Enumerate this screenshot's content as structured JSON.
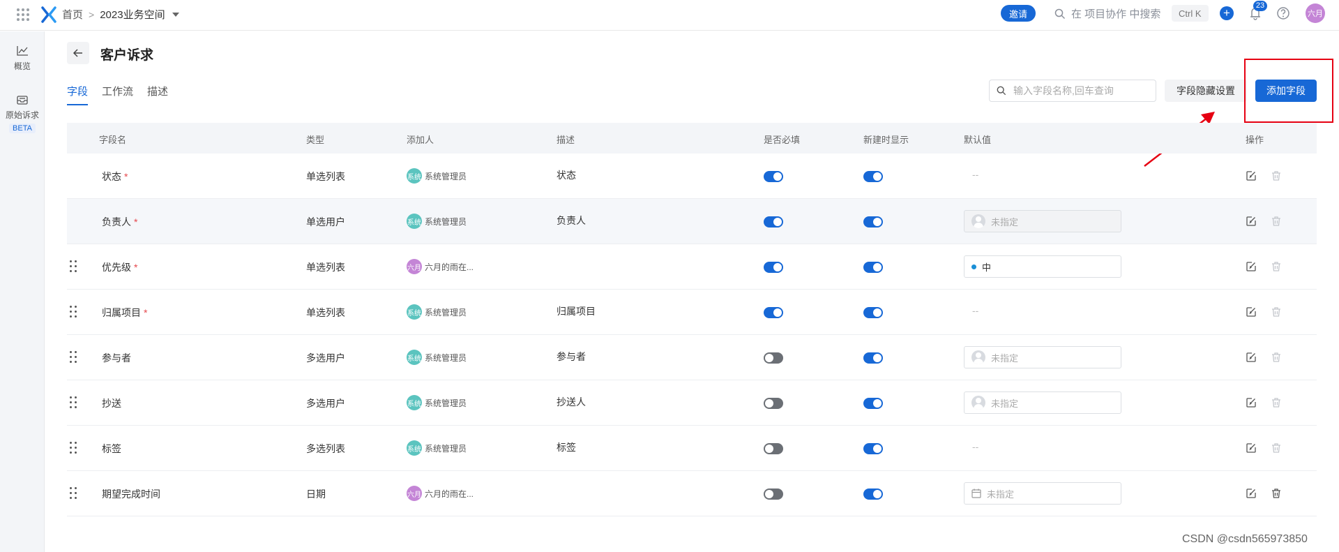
{
  "topbar": {
    "breadcrumb_home": "首页",
    "breadcrumb_sep": ">",
    "workspace": "2023业务空间",
    "invite_label": "邀请",
    "search_placeholder": "在 项目协作 中搜索",
    "shortcut": "Ctrl K",
    "plus": "+",
    "notification_count": "23",
    "user_initials": "六月"
  },
  "sidebar": {
    "items": [
      {
        "label": "概览",
        "icon": "chart-line-icon"
      },
      {
        "label": "原始诉求",
        "icon": "inbox-icon",
        "badge": "BETA"
      }
    ]
  },
  "page": {
    "title": "客户诉求",
    "tabs": [
      {
        "label": "字段",
        "active": true
      },
      {
        "label": "工作流",
        "active": false
      },
      {
        "label": "描述",
        "active": false
      }
    ],
    "field_search_placeholder": "输入字段名称,回车查询",
    "hide_settings_label": "字段隐藏设置",
    "add_field_label": "添加字段"
  },
  "table": {
    "headers": {
      "name": "字段名",
      "type": "类型",
      "creator": "添加人",
      "desc": "描述",
      "required": "是否必填",
      "show_on_create": "新建时显示",
      "default": "默认值",
      "actions": "操作"
    },
    "rows": [
      {
        "name": "状态",
        "required_mark": "*",
        "type": "单选列表",
        "creator": "系统管理员",
        "creator_initials": "系统",
        "creator_color": "#5bc4bf",
        "desc": "状态",
        "required": true,
        "show": true,
        "default": "--",
        "default_kind": "empty",
        "draggable": false,
        "highlight": false,
        "deletable": false
      },
      {
        "name": "负责人",
        "required_mark": "*",
        "type": "单选用户",
        "creator": "系统管理员",
        "creator_initials": "系统",
        "creator_color": "#5bc4bf",
        "desc": "负责人",
        "required": true,
        "show": true,
        "default": "未指定",
        "default_kind": "user-gray",
        "draggable": false,
        "highlight": true,
        "deletable": false
      },
      {
        "name": "优先级",
        "required_mark": "*",
        "type": "单选列表",
        "creator": "六月的雨在...",
        "creator_initials": "六月",
        "creator_color": "#c485d6",
        "desc": "",
        "required": true,
        "show": true,
        "default": "中",
        "default_kind": "option",
        "draggable": true,
        "highlight": false,
        "deletable": false
      },
      {
        "name": "归属项目",
        "required_mark": "*",
        "type": "单选列表",
        "creator": "系统管理员",
        "creator_initials": "系统",
        "creator_color": "#5bc4bf",
        "desc": "归属项目",
        "required": true,
        "show": true,
        "default": "--",
        "default_kind": "empty",
        "draggable": true,
        "highlight": false,
        "deletable": false
      },
      {
        "name": "参与者",
        "required_mark": "",
        "type": "多选用户",
        "creator": "系统管理员",
        "creator_initials": "系统",
        "creator_color": "#5bc4bf",
        "desc": "参与者",
        "required": false,
        "show": true,
        "default": "未指定",
        "default_kind": "user",
        "draggable": true,
        "highlight": false,
        "deletable": false
      },
      {
        "name": "抄送",
        "required_mark": "",
        "type": "多选用户",
        "creator": "系统管理员",
        "creator_initials": "系统",
        "creator_color": "#5bc4bf",
        "desc": "抄送人",
        "required": false,
        "show": true,
        "default": "未指定",
        "default_kind": "user",
        "draggable": true,
        "highlight": false,
        "deletable": false
      },
      {
        "name": "标签",
        "required_mark": "",
        "type": "多选列表",
        "creator": "系统管理员",
        "creator_initials": "系统",
        "creator_color": "#5bc4bf",
        "desc": "标签",
        "required": false,
        "show": true,
        "default": "--",
        "default_kind": "empty",
        "draggable": true,
        "highlight": false,
        "deletable": false
      },
      {
        "name": "期望完成时间",
        "required_mark": "",
        "type": "日期",
        "creator": "六月的雨在...",
        "creator_initials": "六月",
        "creator_color": "#c485d6",
        "desc": "",
        "required": false,
        "show": true,
        "default": "未指定",
        "default_kind": "date",
        "draggable": true,
        "highlight": false,
        "deletable": true
      }
    ]
  },
  "colors": {
    "accent": "#1768d6",
    "annotation": "#e60012"
  },
  "watermark": "CSDN @csdn565973850"
}
